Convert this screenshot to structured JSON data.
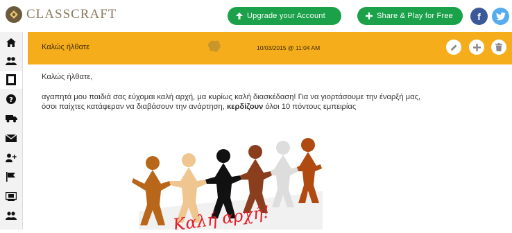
{
  "brand": {
    "name": "CLASSCRAFT",
    "logo_icon": "classcraft-logo-icon"
  },
  "top_actions": {
    "upgrade_label": "Upgrade your Account",
    "share_label": "Share & Play for Free"
  },
  "social": {
    "facebook_glyph": "f",
    "twitter_glyph": "🐦"
  },
  "sidebar": {
    "items": [
      {
        "icon": "home-icon"
      },
      {
        "icon": "users-icon"
      },
      {
        "icon": "book-icon"
      },
      {
        "icon": "help-icon"
      },
      {
        "icon": "truck-icon"
      },
      {
        "icon": "mail-icon"
      },
      {
        "icon": "add-user-icon"
      },
      {
        "icon": "flag-icon"
      },
      {
        "icon": "board-icon"
      },
      {
        "icon": "group-icon"
      }
    ]
  },
  "post": {
    "title": "Καλώς ήλθατε",
    "date": "10/03/2015 @ 11:04 AM",
    "greeting": "Καλώς ήλθατε,",
    "body_before": "αγαπητά μου παιδιά σας εύχομαι καλή αρχή, μα κυρίως καλή διασκέδαση! Για να γιορτάσουμε την έναρξή μας, όσοι παίχτες κατάφεραν να διαβάσουν την ανάρτηση, ",
    "body_bold": "κερδίζουν",
    "body_after": " όλοι 10 πόντους εμπειρίας",
    "image_caption": "Καλή αρχή!"
  },
  "colors": {
    "header": "#f6ad1c",
    "button": "#1aa14a",
    "facebook": "#3b5998",
    "twitter": "#55acee",
    "caption": "#e0202a"
  }
}
